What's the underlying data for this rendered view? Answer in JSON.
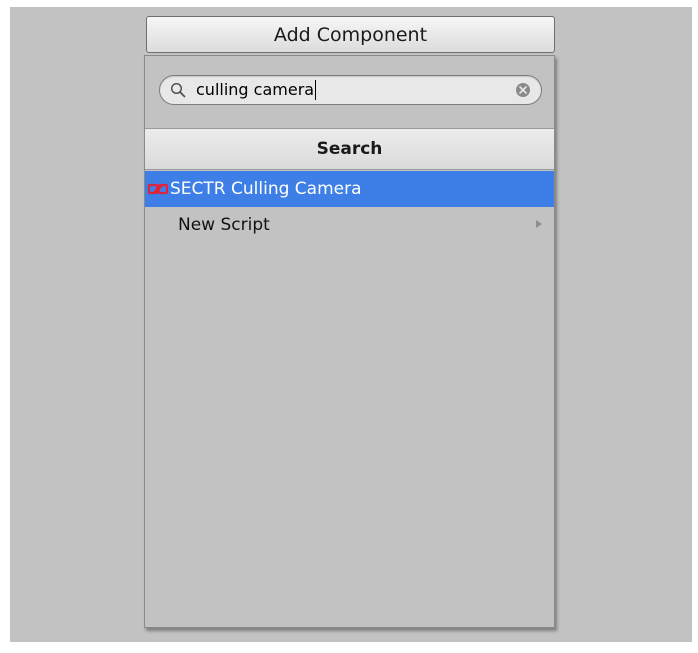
{
  "add_component_button": {
    "label": "Add Component"
  },
  "search": {
    "value": "culling camera",
    "icon": "search-icon",
    "clear_icon": "clear-search-icon"
  },
  "section": {
    "title": "Search"
  },
  "results": [
    {
      "label": "SECTR Culling Camera",
      "icon": "sectr-component-icon",
      "selected": true
    },
    {
      "label": "New Script",
      "icon": "chevron-right-icon",
      "has_submenu": true,
      "selected": false
    }
  ],
  "colors": {
    "selection": "#3d7fe6",
    "panel_background": "#c2c2c2",
    "sectr_icon": "#e0233a"
  }
}
